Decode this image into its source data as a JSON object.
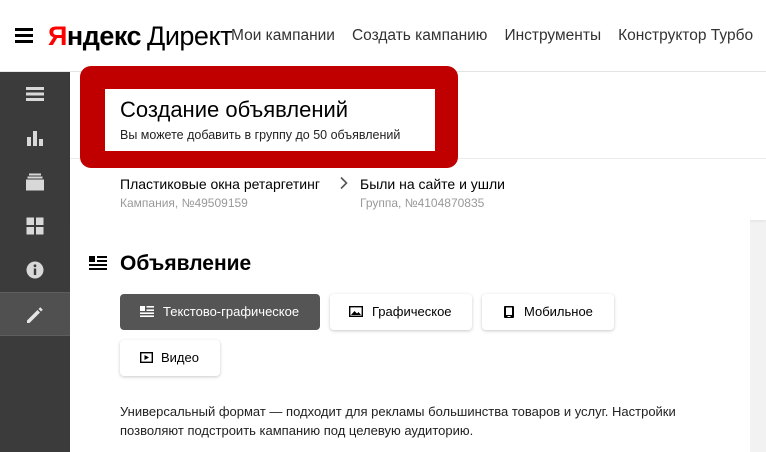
{
  "header": {
    "logo_y": "Я",
    "logo_brand": "ндекс",
    "logo_product": "Директ",
    "nav": [
      {
        "label": "Мои кампании"
      },
      {
        "label": "Создать кампанию"
      },
      {
        "label": "Инструменты"
      },
      {
        "label": "Конструктор Турбо"
      }
    ]
  },
  "sidebar": {
    "items": [
      {
        "icon": "list-icon"
      },
      {
        "icon": "bar-chart-icon"
      },
      {
        "icon": "stack-icon"
      },
      {
        "icon": "grid-icon"
      },
      {
        "icon": "info-icon"
      },
      {
        "icon": "pencil-icon",
        "active": true
      }
    ]
  },
  "page": {
    "title": "Создание объявлений",
    "subtitle": "Вы можете добавить в группу до 50 объявлений",
    "highlight_color": "#c00000",
    "breadcrumb": [
      {
        "name": "Пластиковые окна ретаргетинг",
        "meta": "Кампания, №49509159"
      },
      {
        "name": "Были на сайте и ушли",
        "meta": "Группа, №4104870835"
      }
    ]
  },
  "ad_section": {
    "title": "Объявление",
    "formats": [
      {
        "label": "Текстово-графическое",
        "icon": "text-image-icon",
        "active": true
      },
      {
        "label": "Графическое",
        "icon": "image-icon"
      },
      {
        "label": "Мобильное",
        "icon": "mobile-icon"
      },
      {
        "label": "Видео",
        "icon": "video-icon"
      }
    ],
    "description": "Универсальный формат — подходит для рекламы большинства товаров и услуг. Настройки позволяют подстроить кампанию под целевую аудиторию."
  }
}
